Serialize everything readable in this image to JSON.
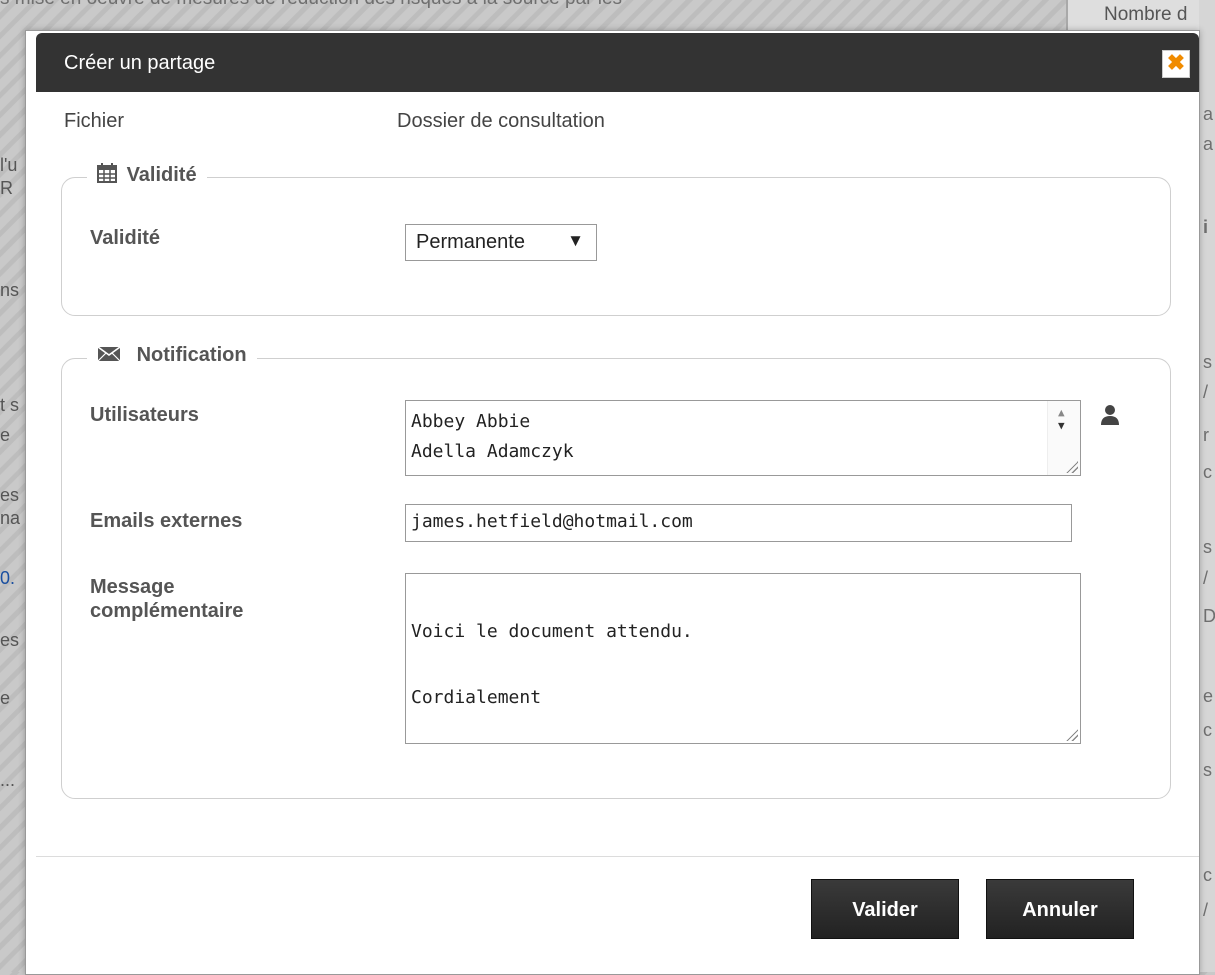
{
  "background": {
    "top_fragment": "s mise en oeuvre de mesures de réduction des risques à la source par les",
    "top_right": "Nombre d",
    "left_fragments": [
      "l'u",
      "R",
      "ns",
      "t s",
      "e",
      "es",
      "na",
      "0.",
      "es",
      "e",
      "..."
    ],
    "right_fragments": [
      "a",
      "a",
      "i",
      "s",
      "/",
      "r",
      "c",
      "s",
      "/",
      "D",
      "e",
      "c",
      "s",
      "c",
      "/"
    ]
  },
  "dialog": {
    "title": "Créer un partage",
    "close_symbol": "✖",
    "file_label": "Fichier",
    "file_value": "Dossier de consultation"
  },
  "validity": {
    "legend": "Validité",
    "label": "Validité",
    "selected": "Permanente",
    "arrow": "▼"
  },
  "notification": {
    "legend": "Notification",
    "users_label": "Utilisateurs",
    "users": [
      "Abbey Abbie",
      "Adella Adamczyk"
    ],
    "emails_label": "Emails externes",
    "emails_value": "james.hetfield@hotmail.com",
    "message_label_line1": "Message",
    "message_label_line2": "complémentaire",
    "message_value": "Voici le document attendu.\n\nCordialement"
  },
  "buttons": {
    "validate": "Valider",
    "cancel": "Annuler"
  },
  "colors": {
    "titlebar": "#333333",
    "close_x": "#f08b00",
    "button": "#2d2d2d"
  },
  "icons": {
    "validity": "calendar-icon",
    "notification": "envelope-icon",
    "user_picker": "user-icon"
  }
}
